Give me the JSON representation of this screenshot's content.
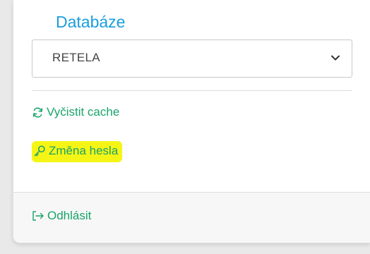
{
  "panel": {
    "database_label": "Databáze",
    "database_select": {
      "value": "RETELA",
      "options": [
        "RETELA"
      ]
    },
    "actions": {
      "clear_cache": {
        "label": "Vyčistit cache",
        "icon": "refresh-icon"
      },
      "change_password": {
        "label": "Změna hesla",
        "icon": "key-icon",
        "highlight": "#f5f515"
      }
    },
    "footer": {
      "logout": {
        "label": "Odhlásit",
        "icon": "logout-icon"
      }
    }
  },
  "colors": {
    "label_blue": "#1a9ee0",
    "link_green": "#1aa36a",
    "highlight": "#f5f515"
  }
}
